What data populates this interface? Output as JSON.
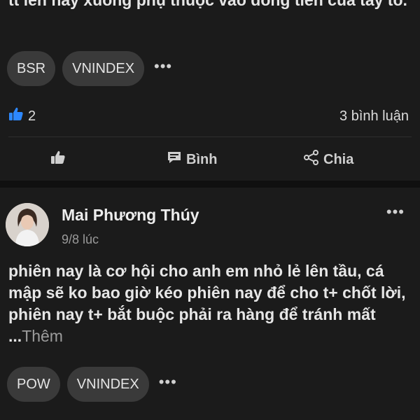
{
  "post1": {
    "text_tail": "tt lên hay xuống phụ thuộc vào dòng tiền của tay to.",
    "tags": [
      "BSR",
      "VNINDEX"
    ],
    "more": "•••",
    "like_count": "2",
    "comment_count": "3 bình luận",
    "actions": {
      "like_label": "",
      "comment_label": "Bình",
      "share_label": "Chia"
    }
  },
  "post2": {
    "author": "Mai Phương Thúy",
    "time": "9/8 lúc",
    "menu": "•••",
    "text": "phiên nay là cơ hội cho anh em nhỏ lẻ lên tầu, cá mập sẽ ko bao giờ kéo phiên nay để cho t+ chốt lời, phiên nay t+ bắt buộc phải ra hàng để tránh mất ...",
    "see_more": "Thêm",
    "tags": [
      "POW",
      "VNINDEX"
    ],
    "more": "•••"
  },
  "colors": {
    "background": "#101010",
    "card": "#1b1b1b",
    "tag_bg": "#3a3a3a",
    "like_blue": "#2d88ff"
  }
}
